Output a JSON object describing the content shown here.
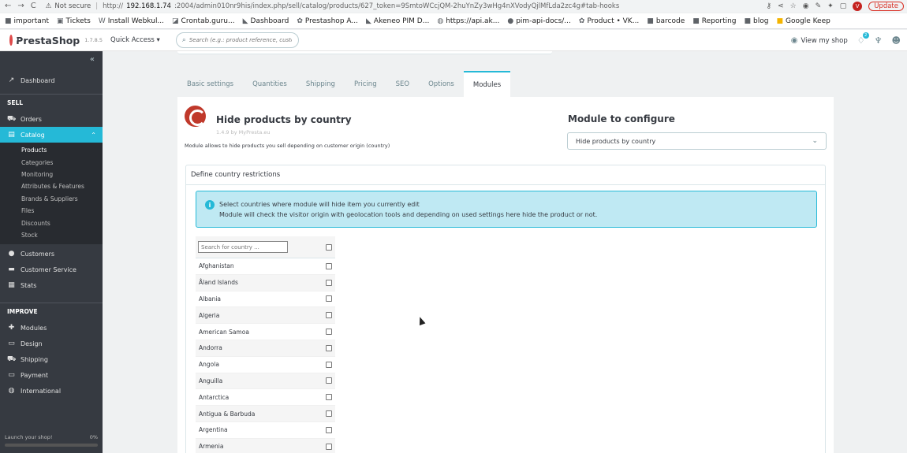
{
  "browser": {
    "nav_back": "←",
    "nav_forward": "→",
    "nav_reload": "C",
    "security": "Not secure",
    "host": "192.168.1.74",
    "url_prefix": "http://",
    "url_path": ":2004/admin010nr9his/index.php/sell/catalog/products/627_token=9SmtoWCcjQM-2huYnZy3wHg4nXVodyQjlMfLda2zc4g#tab-hooks",
    "avatar_letter": "V",
    "update_label": "Update"
  },
  "bookmarks": [
    {
      "label": "important",
      "icon": "folder-icon"
    },
    {
      "label": "Tickets",
      "icon": "bookmark-icon"
    },
    {
      "label": "Install Webkul...",
      "icon": "bookmark-icon"
    },
    {
      "label": "Crontab.guru...",
      "icon": "bookmark-icon"
    },
    {
      "label": "Dashboard",
      "icon": "bookmark-icon"
    },
    {
      "label": "Prestashop A...",
      "icon": "bookmark-icon"
    },
    {
      "label": "Akeneo PIM D...",
      "icon": "bookmark-icon"
    },
    {
      "label": "https://api.ak...",
      "icon": "bookmark-icon"
    },
    {
      "label": "pim-api-docs/...",
      "icon": "github-icon"
    },
    {
      "label": "Product • VK...",
      "icon": "bookmark-icon"
    },
    {
      "label": "barcode",
      "icon": "folder-icon"
    },
    {
      "label": "Reporting",
      "icon": "folder-icon"
    },
    {
      "label": "blog",
      "icon": "folder-icon"
    },
    {
      "label": "Google Keep",
      "icon": "bookmark-icon"
    }
  ],
  "header": {
    "logo_text": "PrestaShop",
    "version": "1.7.8.5",
    "quick_access": "Quick Access ▾",
    "search_placeholder": "Search (e.g.: product reference, custom",
    "view_shop": "View my shop",
    "notif_badge": "2"
  },
  "sidebar": {
    "collapse_glyph": "«",
    "dashboard": "Dashboard",
    "sell_section": "SELL",
    "orders": "Orders",
    "catalog": "Catalog",
    "catalog_sub": [
      "Products",
      "Categories",
      "Monitoring",
      "Attributes & Features",
      "Brands & Suppliers",
      "Files",
      "Discounts",
      "Stock"
    ],
    "customers": "Customers",
    "customer_service": "Customer Service",
    "stats": "Stats",
    "improve_section": "IMPROVE",
    "modules": "Modules",
    "design": "Design",
    "shipping": "Shipping",
    "payment": "Payment",
    "international": "International",
    "launch_label": "Launch your shop!",
    "launch_percent": "0%",
    "launch_progress": 0
  },
  "tabs": [
    "Basic settings",
    "Quantities",
    "Shipping",
    "Pricing",
    "SEO",
    "Options",
    "Modules"
  ],
  "active_tab": "Modules",
  "module": {
    "title": "Hide products by country",
    "version": "1.4.9 by MyPresta.eu",
    "description": "Module allows to hide products you sell depending on customer origin (country)",
    "configure_title": "Module to configure",
    "configure_selected": "Hide products by country"
  },
  "restrictions": {
    "title": "Define country restrictions",
    "alert_line1": "Select countries where module will hide item you currently edit",
    "alert_line2": "Module will check the visitor origin with geolocation tools and depending on used settings here hide the product or not.",
    "search_placeholder": "Search for country ...",
    "countries": [
      "Afghanistan",
      "Åland Islands",
      "Albania",
      "Algeria",
      "American Samoa",
      "Andorra",
      "Angola",
      "Anguilla",
      "Antarctica",
      "Antigua & Barbuda",
      "Argentina",
      "Armenia"
    ]
  }
}
